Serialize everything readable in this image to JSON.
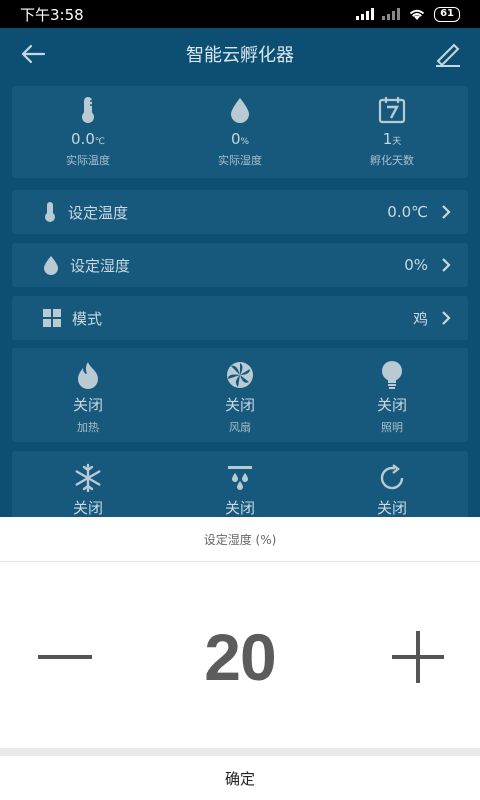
{
  "status": {
    "time": "下午3:58",
    "battery": "61"
  },
  "header": {
    "title": "智能云孵化器"
  },
  "metrics": [
    {
      "value": "0.0",
      "unit": "℃",
      "label": "实际温度",
      "icon": "thermometer-icon"
    },
    {
      "value": "0",
      "unit": "%",
      "label": "实际湿度",
      "icon": "droplet-icon"
    },
    {
      "value": "1",
      "unit": "天",
      "label": "孵化天数",
      "icon": "calendar-icon"
    }
  ],
  "rows": {
    "temp": {
      "label": "设定温度",
      "value": "0.0℃"
    },
    "humidity": {
      "label": "设定湿度",
      "value": "0%"
    },
    "mode": {
      "label": "模式",
      "value": "鸡"
    }
  },
  "devices": [
    {
      "state": "关闭",
      "name": "加热",
      "icon": "flame-icon"
    },
    {
      "state": "关闭",
      "name": "风扇",
      "icon": "fan-icon"
    },
    {
      "state": "关闭",
      "name": "照明",
      "icon": "bulb-icon"
    },
    {
      "state": "关闭",
      "icon": "snowflake-icon"
    },
    {
      "state": "关闭",
      "icon": "sprinkler-icon"
    },
    {
      "state": "关闭",
      "icon": "rotate-icon"
    }
  ],
  "sheet": {
    "title": "设定湿度 (%)",
    "value": "20",
    "confirm": "确定"
  }
}
